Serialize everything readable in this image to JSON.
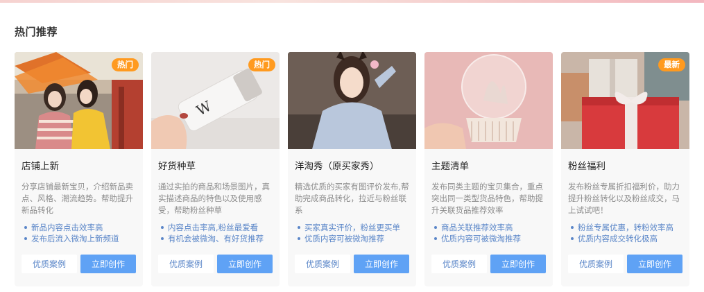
{
  "section": {
    "title": "热门推荐"
  },
  "cards": [
    {
      "badge": "热门",
      "title": "店铺上新",
      "description": "分享店铺最新宝贝，介绍新品卖点、风格、潮流趋势。帮助提升新品转化",
      "bullets": [
        "新品内容点击效率高",
        "发布后流入微淘上新频道"
      ],
      "case_label": "优质案例",
      "create_label": "立即创作"
    },
    {
      "badge": "热门",
      "title": "好货种草",
      "description": "通过实拍的商品和场景图片，真实描述商品的特色以及使用感受，帮助粉丝种草",
      "bullets": [
        "内容点击率高,粉丝最爱看",
        "有机会被微淘、有好货推荐"
      ],
      "case_label": "优质案例",
      "create_label": "立即创作"
    },
    {
      "badge": "",
      "title": "洋淘秀（原买家秀）",
      "description": "精选优质的买家有图评价发布,帮助完成商品转化，拉近与粉丝联系",
      "bullets": [
        "买家真实评价，粉丝更买单",
        "优质内容可被微淘推荐"
      ],
      "case_label": "优质案例",
      "create_label": "立即创作"
    },
    {
      "badge": "",
      "title": "主题清单",
      "description": "发布同类主题的宝贝集合，重点突出同一类型货品特色，帮助提升关联货品推荐效率",
      "bullets": [
        "商品关联推荐效率高",
        "优质内容可被微淘推荐"
      ],
      "case_label": "优质案例",
      "create_label": "立即创作"
    },
    {
      "badge": "最新",
      "title": "粉丝福利",
      "description": "发布粉丝专属折扣福利价，助力提升粉丝转化以及粉丝成交，马上试试吧！",
      "bullets": [
        "粉丝专属优惠，转粉效率高",
        "优质内容成交转化极高"
      ],
      "case_label": "优质案例",
      "create_label": "立即创作"
    }
  ],
  "colors": {
    "accent": "#5fa2f5",
    "link": "#5a86c8",
    "badge": "#ff9a1f",
    "card_bg": "#f8f8f8"
  }
}
